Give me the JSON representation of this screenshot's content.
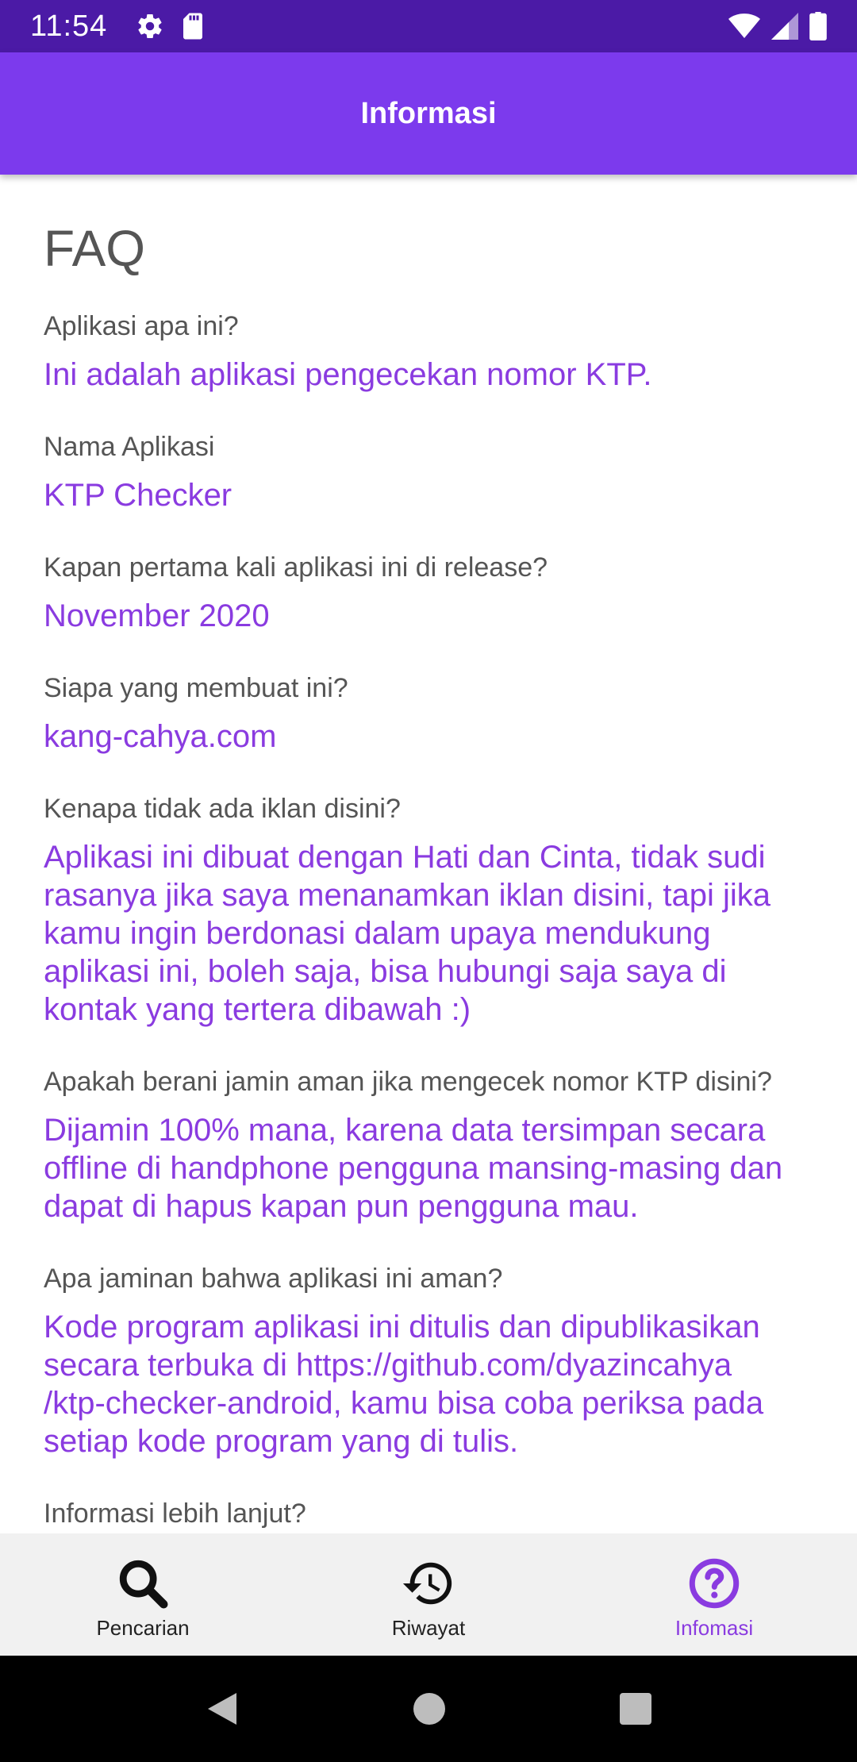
{
  "status_bar": {
    "time": "11:54",
    "icons": [
      "settings-icon",
      "sd-card-icon",
      "wifi-icon",
      "signal-icon",
      "battery-icon"
    ]
  },
  "app_bar": {
    "title": "Informasi"
  },
  "faq": {
    "heading": "FAQ",
    "items": [
      {
        "question": "Aplikasi apa ini?",
        "answer": "Ini adalah aplikasi pengecekan nomor KTP."
      },
      {
        "question": "Nama Aplikasi",
        "answer": "KTP Checker"
      },
      {
        "question": "Kapan pertama kali aplikasi ini di release?",
        "answer": "November 2020"
      },
      {
        "question": "Siapa yang membuat ini?",
        "answer": "kang-cahya.com"
      },
      {
        "question": "Kenapa tidak ada iklan disini?",
        "answer": "Aplikasi ini dibuat dengan Hati dan Cinta, tidak sudi rasanya jika saya menanamkan iklan disini, tapi jika kamu ingin berdonasi dalam upaya mendukung aplikasi ini, boleh saja, bisa hubungi saja saya di kontak yang tertera dibawah :)"
      },
      {
        "question": "Apakah berani jamin aman jika mengecek nomor KTP disini?",
        "answer": "Dijamin 100% mana, karena data tersimpan secara offline di handphone pengguna mansing-masing dan dapat di hapus kapan pun pengguna mau."
      },
      {
        "question": "Apa jaminan bahwa aplikasi ini aman?",
        "answer": "Kode program aplikasi ini ditulis dan dipublikasikan secara terbuka di https://github.com/dyazincahya\n/ktp-checker-android, kamu bisa coba periksa pada setiap kode program yang di tulis."
      },
      {
        "question": "Informasi lebih lanjut?",
        "answer": ""
      }
    ]
  },
  "bottom_nav": {
    "items": [
      {
        "label": "Pencarian",
        "icon": "search-icon",
        "active": false
      },
      {
        "label": "Riwayat",
        "icon": "history-icon",
        "active": false
      },
      {
        "label": "Infomasi",
        "icon": "help-circle-icon",
        "active": true
      }
    ]
  },
  "colors": {
    "status_bar": "#4b1aa6",
    "app_bar": "#7c3aed",
    "accent": "#8a3be0",
    "question_text": "#555555"
  }
}
